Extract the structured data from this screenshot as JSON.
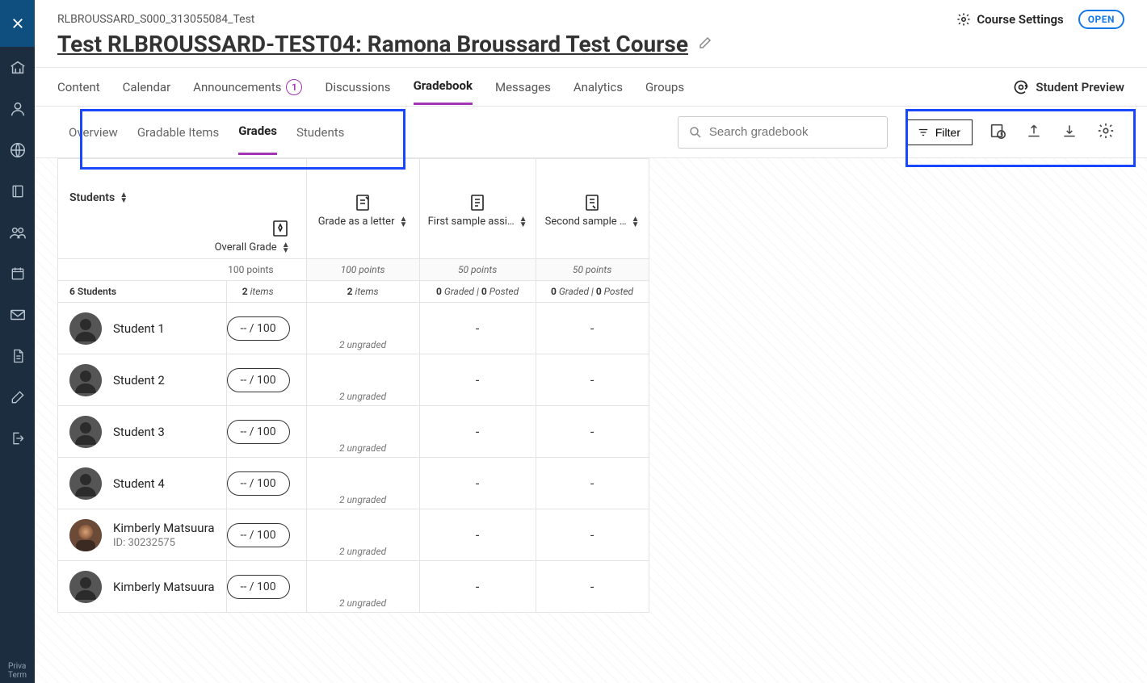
{
  "rail": {
    "footer1": "Priva",
    "footer2": "Term"
  },
  "header": {
    "breadcrumb": "RLBROUSSARD_S000_313055084_Test",
    "course_settings": "Course Settings",
    "open_pill": "OPEN",
    "title": "Test RLBROUSSARD-TEST04: Ramona Broussard Test Course"
  },
  "topnav": {
    "items": [
      {
        "label": "Content"
      },
      {
        "label": "Calendar"
      },
      {
        "label": "Announcements",
        "badge": "1"
      },
      {
        "label": "Discussions"
      },
      {
        "label": "Gradebook",
        "active": true
      },
      {
        "label": "Messages"
      },
      {
        "label": "Analytics"
      },
      {
        "label": "Groups"
      }
    ],
    "preview": "Student Preview"
  },
  "subtabs": [
    {
      "label": "Overview"
    },
    {
      "label": "Gradable Items"
    },
    {
      "label": "Grades",
      "active": true
    },
    {
      "label": "Students"
    }
  ],
  "search": {
    "placeholder": "Search gradebook"
  },
  "filter": {
    "label": "Filter"
  },
  "columns": {
    "students": "Students",
    "overall": "Overall Grade",
    "grade_letter": "Grade as a letter",
    "first": "First sample assi…",
    "second": "Second sample …"
  },
  "points_row": {
    "blank": "",
    "overall": "100 points",
    "grade_letter": "100 points",
    "first": "50 points",
    "second": "50 points"
  },
  "summary_row": {
    "students_count_n": "6",
    "students_count_txt": " Students",
    "overall_n": "2",
    "overall_txt": " items",
    "grade_letter_n": "2",
    "grade_letter_txt": " items",
    "first_graded_n": "0",
    "first_graded_txt": " Graded | ",
    "first_posted_n": "0",
    "first_posted_txt": " Posted",
    "second_graded_n": "0",
    "second_graded_txt": " Graded | ",
    "second_posted_n": "0",
    "second_posted_txt": " Posted"
  },
  "students": [
    {
      "name": "Student 1",
      "id": "",
      "overall": "-- / 100",
      "letter_sub": "2 ungraded",
      "first": "-",
      "second": "-",
      "avatar": "generic"
    },
    {
      "name": "Student 2",
      "id": "",
      "overall": "-- / 100",
      "letter_sub": "2 ungraded",
      "first": "-",
      "second": "-",
      "avatar": "generic"
    },
    {
      "name": "Student 3",
      "id": "",
      "overall": "-- / 100",
      "letter_sub": "2 ungraded",
      "first": "-",
      "second": "-",
      "avatar": "generic"
    },
    {
      "name": "Student 4",
      "id": "",
      "overall": "-- / 100",
      "letter_sub": "2 ungraded",
      "first": "-",
      "second": "-",
      "avatar": "generic"
    },
    {
      "name": "Kimberly Matsuura",
      "id": "ID: 30232575",
      "overall": "-- / 100",
      "letter_sub": "2 ungraded",
      "first": "-",
      "second": "-",
      "avatar": "photo"
    },
    {
      "name": "Kimberly Matsuura",
      "id": "",
      "overall": "-- / 100",
      "letter_sub": "2 ungraded",
      "first": "-",
      "second": "-",
      "avatar": "generic"
    }
  ]
}
